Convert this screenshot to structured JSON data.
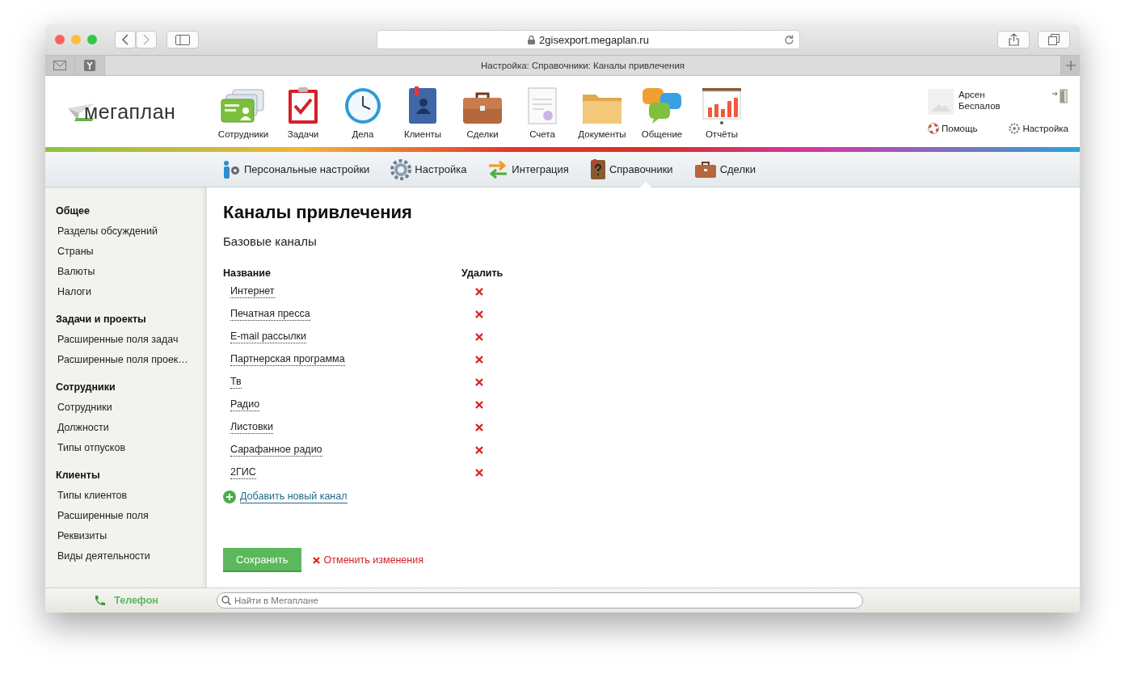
{
  "browser": {
    "url": "2gisexport.megaplan.ru",
    "tab_title": "Настройка: Справочники: Каналы привлечения"
  },
  "header": {
    "logo": "мегаплан",
    "modules": [
      {
        "label": "Сотрудники"
      },
      {
        "label": "Задачи"
      },
      {
        "label": "Дела"
      },
      {
        "label": "Клиенты"
      },
      {
        "label": "Сделки"
      },
      {
        "label": "Счета"
      },
      {
        "label": "Документы"
      },
      {
        "label": "Общение"
      },
      {
        "label": "Отчёты"
      }
    ],
    "user": {
      "first_name": "Арсен",
      "last_name": "Беспалов"
    },
    "links": [
      "Помощь",
      "Настройка"
    ]
  },
  "subnav": [
    {
      "label": "Персональные настройки",
      "selected": false
    },
    {
      "label": "Настройка",
      "selected": false
    },
    {
      "label": "Интеграция",
      "selected": false
    },
    {
      "label": "Справочники",
      "selected": true
    },
    {
      "label": "Сделки",
      "selected": false
    }
  ],
  "sidebar": [
    {
      "heading": "Общее",
      "items": [
        "Разделы обсуждений",
        "Страны",
        "Валюты",
        "Налоги"
      ]
    },
    {
      "heading": "Задачи и проекты",
      "items": [
        "Расширенные поля задач",
        "Расширенные поля проек…"
      ]
    },
    {
      "heading": "Сотрудники",
      "items": [
        "Сотрудники",
        "Должности",
        "Типы отпусков"
      ]
    },
    {
      "heading": "Клиенты",
      "items": [
        "Типы клиентов",
        "Расширенные поля",
        "Реквизиты",
        "Виды деятельности"
      ]
    }
  ],
  "main": {
    "title": "Каналы привлечения",
    "subtitle": "Базовые каналы",
    "columns": [
      "Название",
      "Удалить"
    ],
    "rows": [
      "Интернет",
      "Печатная пресса",
      "E-mail рассылки",
      "Партнерская программа",
      "Тв",
      "Радио",
      "Листовки",
      "Сарафанное радио",
      "2ГИС"
    ],
    "add_link": "Добавить новый канал",
    "save_button": "Сохранить",
    "cancel_link": "Отменить изменения"
  },
  "footer": {
    "phone": "Телефон",
    "search_placeholder": "Найти в Мегаплане"
  }
}
